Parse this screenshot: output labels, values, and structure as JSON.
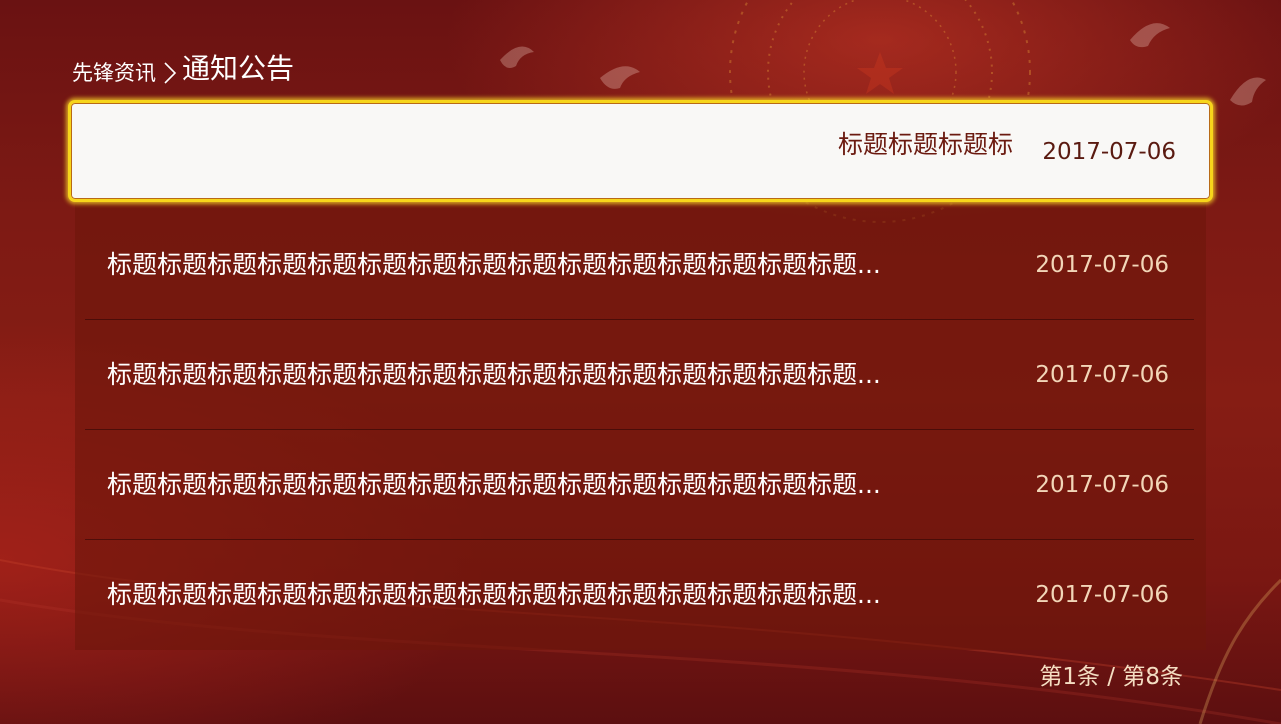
{
  "breadcrumb": {
    "parent": "先锋资讯",
    "separator_icon": "chevron-right-icon",
    "current": "通知公告"
  },
  "list": {
    "items": [
      {
        "title": "标题标题标题标",
        "date": "2017-07-06",
        "focused": true
      },
      {
        "title": "标题标题标题标题标题标题标题标题标题标题标题标题标题标题标题...",
        "date": "2017-07-06",
        "focused": false
      },
      {
        "title": "标题标题标题标题标题标题标题标题标题标题标题标题标题标题标题...",
        "date": "2017-07-06",
        "focused": false
      },
      {
        "title": "标题标题标题标题标题标题标题标题标题标题标题标题标题标题标题...",
        "date": "2017-07-06",
        "focused": false
      },
      {
        "title": "标题标题标题标题标题标题标题标题标题标题标题标题标题标题标题...",
        "date": "2017-07-06",
        "focused": false
      }
    ]
  },
  "pager": {
    "text": "第1条 / 第8条"
  },
  "colors": {
    "background": "#861d14",
    "focus_border": "#f7d51b",
    "focus_fill": "#f9f8f6",
    "date_text": "#f2d6b8"
  },
  "background_icons": [
    "national-emblem-icon",
    "dove-icon"
  ]
}
